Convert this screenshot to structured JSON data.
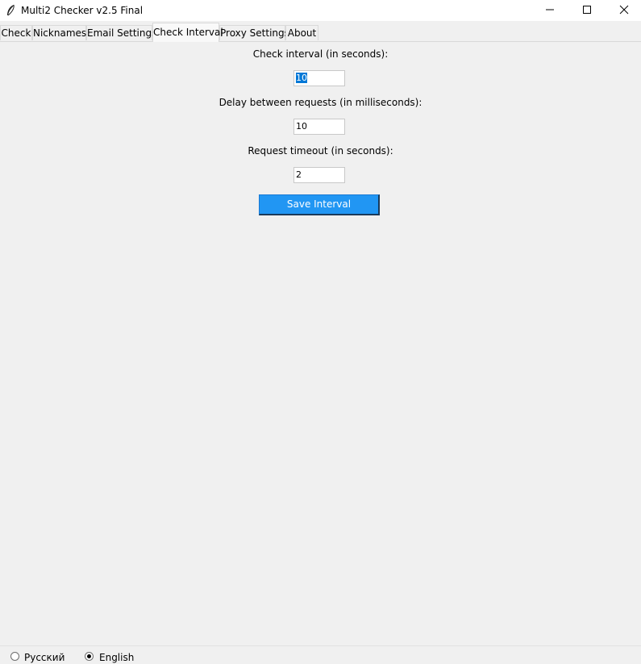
{
  "window": {
    "title": "Multi2 Checker v2.5 Final"
  },
  "tabs": [
    {
      "label": "Check"
    },
    {
      "label": "Nicknames"
    },
    {
      "label": "Email Settings"
    },
    {
      "label": "Check Interval",
      "active": true
    },
    {
      "label": "Proxy Settings"
    },
    {
      "label": "About"
    }
  ],
  "form": {
    "interval_label": "Check interval (in seconds):",
    "interval_value": "10",
    "delay_label": "Delay between requests (in milliseconds):",
    "delay_value": "10",
    "timeout_label": "Request timeout (in seconds):",
    "timeout_value": "2",
    "save_label": "Save Interval"
  },
  "language": {
    "options": [
      {
        "label": "Русский",
        "selected": false
      },
      {
        "label": "English",
        "selected": true
      }
    ]
  },
  "icons": {
    "app": "feather-icon",
    "minimize": "minimize-icon",
    "maximize": "maximize-icon",
    "close": "close-icon"
  },
  "colors": {
    "accent": "#2196f3",
    "selection": "#0078d7",
    "background": "#f0f0f0"
  }
}
